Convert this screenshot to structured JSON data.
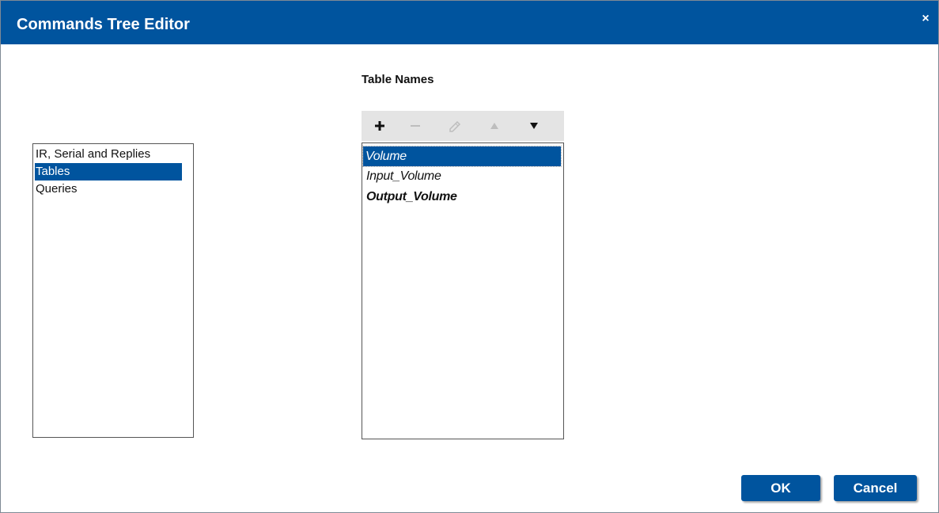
{
  "window": {
    "title": "Commands Tree Editor",
    "close_glyph": "×"
  },
  "colors": {
    "accent": "#00549e",
    "toolbar_bg": "#e4e4e4"
  },
  "left_list": {
    "items": [
      {
        "label": "IR, Serial and Replies",
        "selected": false
      },
      {
        "label": "Tables",
        "selected": true
      },
      {
        "label": "Queries",
        "selected": false
      }
    ]
  },
  "table_section": {
    "label": "Table Names",
    "toolbar": [
      {
        "name": "add-icon",
        "enabled": true
      },
      {
        "name": "remove-icon",
        "enabled": false
      },
      {
        "name": "edit-icon",
        "enabled": false
      },
      {
        "name": "move-up-icon",
        "enabled": false
      },
      {
        "name": "move-down-icon",
        "enabled": true
      }
    ],
    "items": [
      {
        "label": "Volume",
        "selected": true
      },
      {
        "label": "Input_Volume",
        "selected": false
      },
      {
        "label": "Output_Volume",
        "selected": false
      }
    ]
  },
  "footer": {
    "ok_label": "OK",
    "cancel_label": "Cancel"
  }
}
